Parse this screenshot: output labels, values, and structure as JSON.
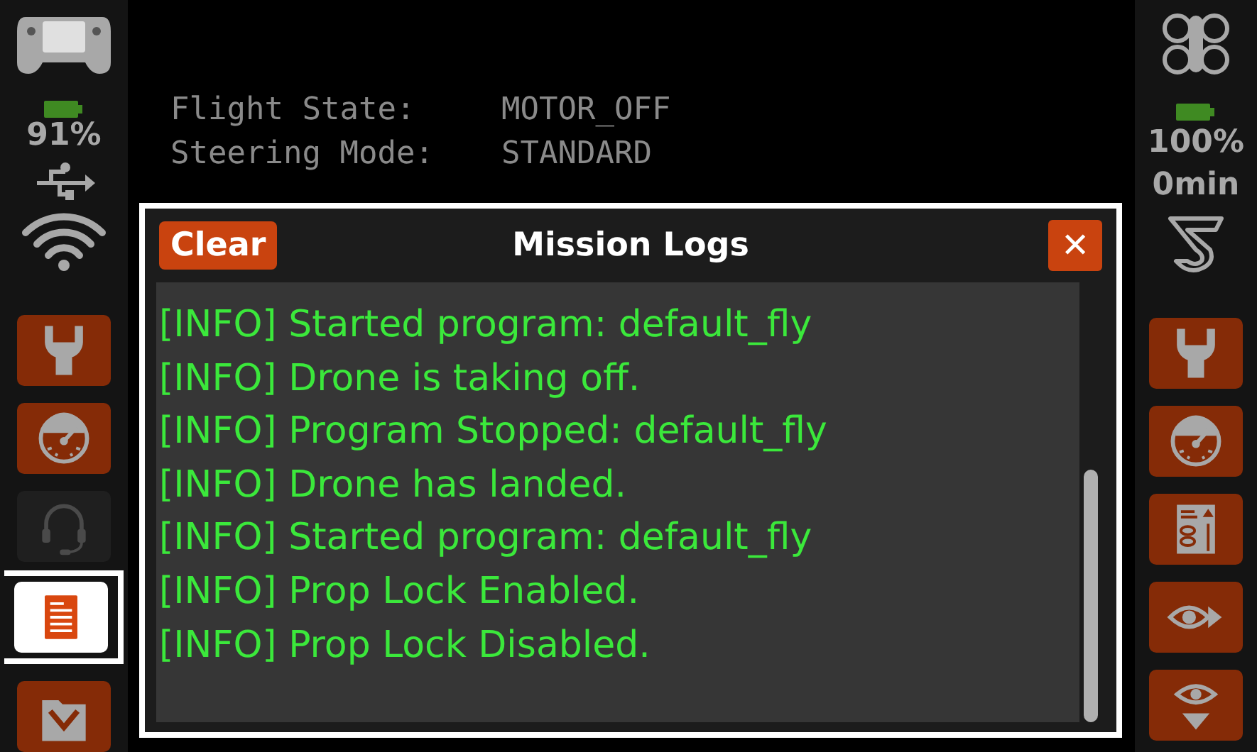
{
  "left_sidebar": {
    "battery": "91%",
    "buttons": [
      {
        "kind": "wrench",
        "selected": false,
        "disabled": false
      },
      {
        "kind": "gauge",
        "selected": false,
        "disabled": false
      },
      {
        "kind": "headset",
        "selected": false,
        "disabled": true
      },
      {
        "kind": "log",
        "selected": true,
        "disabled": false
      },
      {
        "kind": "folder",
        "selected": false,
        "disabled": false
      }
    ]
  },
  "status_lines": [
    {
      "label": "Flight State:",
      "value": "MOTOR_OFF"
    },
    {
      "label": "Steering Mode:",
      "value": "STANDARD"
    }
  ],
  "dialog": {
    "clear_button": "Clear",
    "title": "Mission Logs",
    "close_button": "✕",
    "log_lines": [
      "[INFO] Started program: default_fly",
      "[INFO] Drone is taking off.",
      "[INFO] Program Stopped: default_fly",
      "[INFO] Drone has landed.",
      "[INFO] Started program: default_fly",
      "[INFO] Prop Lock Enabled.",
      "[INFO] Prop Lock Disabled."
    ]
  },
  "right_sidebar": {
    "battery": "100%",
    "flight_time": "0min",
    "buttons": [
      {
        "kind": "wrench",
        "selected": false,
        "disabled": false
      },
      {
        "kind": "gauge",
        "selected": false,
        "disabled": false
      },
      {
        "kind": "drone-doc",
        "selected": false,
        "disabled": false
      },
      {
        "kind": "eye-right",
        "selected": false,
        "disabled": false
      },
      {
        "kind": "eye-down",
        "selected": false,
        "disabled": false
      }
    ]
  }
}
